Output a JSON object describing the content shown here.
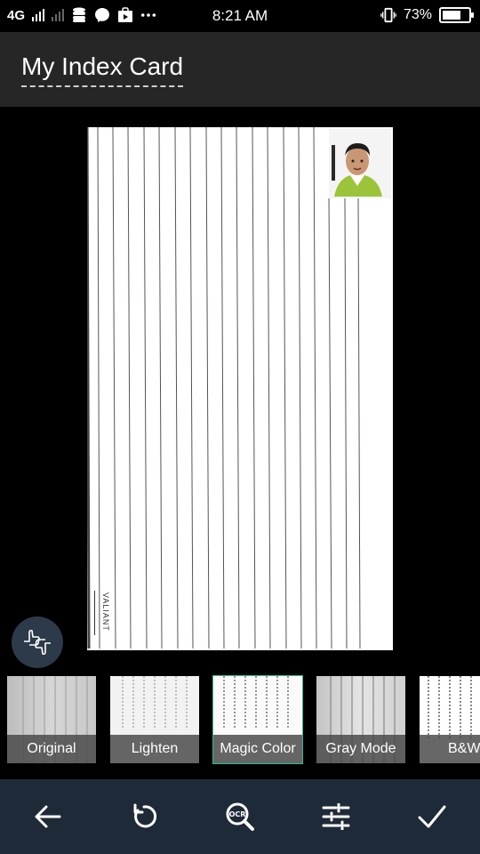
{
  "status_bar": {
    "network": "4G",
    "time": "8:21 AM",
    "battery_percent_text": "73%",
    "battery_level": 0.73,
    "icons": [
      "signal-icon",
      "signal-weak-icon",
      "database-icon",
      "messenger-icon",
      "play-bag-icon",
      "more-dots-icon",
      "vibrate-icon",
      "battery-icon"
    ]
  },
  "header": {
    "title": "My Index Card"
  },
  "card": {
    "brand": "VALIANT"
  },
  "filters": [
    {
      "label": "Original",
      "selected": false
    },
    {
      "label": "Lighten",
      "selected": false
    },
    {
      "label": "Magic Color",
      "selected": true
    },
    {
      "label": "Gray Mode",
      "selected": false
    },
    {
      "label": "B&W",
      "selected": false
    }
  ],
  "toolbar": {
    "items": [
      "back-arrow-icon",
      "rotate-icon",
      "ocr-icon",
      "adjust-sliders-icon",
      "confirm-check-icon"
    ]
  },
  "colors": {
    "header_bg": "#262626",
    "toolbar_bg": "#1f2a38",
    "selected_accent": "#2bbf9a",
    "gesture_button_bg": "#2d3a4a"
  }
}
